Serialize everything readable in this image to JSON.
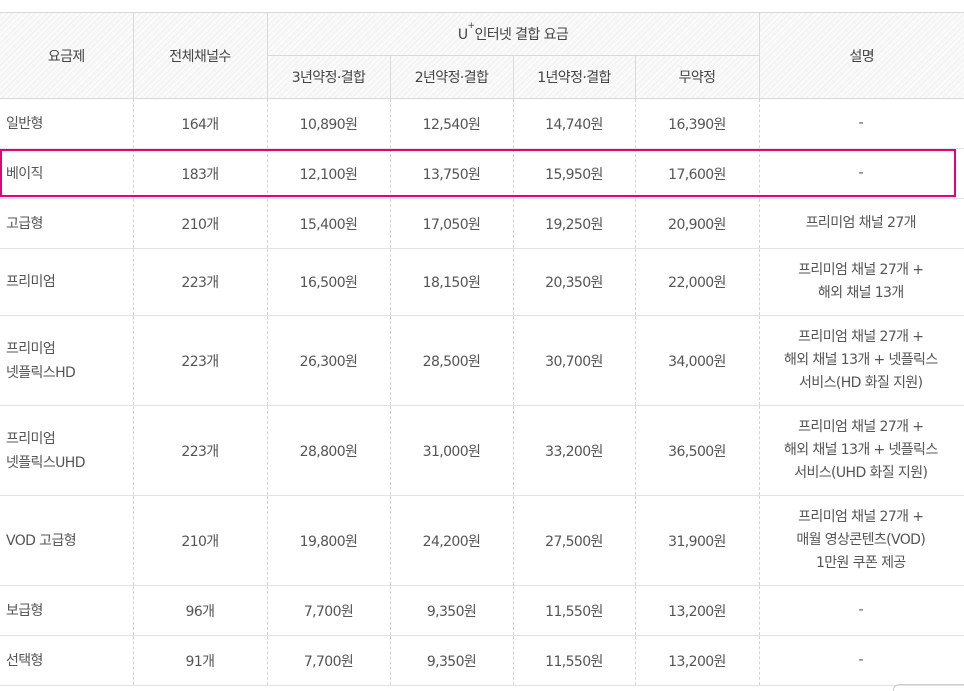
{
  "table": {
    "headers": {
      "plan": "요금제",
      "channels": "전체채널수",
      "group_u": "U",
      "group_plus": "+",
      "group_rest": "인터넷 결합 요금",
      "y3": "3년약정·결합",
      "y2": "2년약정·결합",
      "y1": "1년약정·결합",
      "none": "무약정",
      "desc": "설명"
    },
    "rows": [
      {
        "plan": [
          "일반형"
        ],
        "channels": "164개",
        "y3": "10,890원",
        "y2": "12,540원",
        "y1": "14,740원",
        "none": "16,390원",
        "desc": [
          "-"
        ]
      },
      {
        "plan": [
          "베이직"
        ],
        "channels": "183개",
        "y3": "12,100원",
        "y2": "13,750원",
        "y1": "15,950원",
        "none": "17,600원",
        "desc": [
          "-"
        ]
      },
      {
        "plan": [
          "고급형"
        ],
        "channels": "210개",
        "y3": "15,400원",
        "y2": "17,050원",
        "y1": "19,250원",
        "none": "20,900원",
        "desc": [
          "프리미엄 채널 27개"
        ]
      },
      {
        "plan": [
          "프리미엄"
        ],
        "channels": "223개",
        "y3": "16,500원",
        "y2": "18,150원",
        "y1": "20,350원",
        "none": "22,000원",
        "desc": [
          "프리미엄 채널 27개 +",
          "해외 채널 13개"
        ]
      },
      {
        "plan": [
          "프리미엄",
          "넷플릭스HD"
        ],
        "channels": "223개",
        "y3": "26,300원",
        "y2": "28,500원",
        "y1": "30,700원",
        "none": "34,000원",
        "desc": [
          "프리미엄 채널 27개 +",
          "해외 채널 13개 + 넷플릭스",
          "서비스(HD 화질 지원)"
        ]
      },
      {
        "plan": [
          "프리미엄",
          "넷플릭스UHD"
        ],
        "channels": "223개",
        "y3": "28,800원",
        "y2": "31,000원",
        "y1": "33,200원",
        "none": "36,500원",
        "desc": [
          "프리미엄 채널 27개 +",
          "해외 채널 13개 + 넷플릭스",
          "서비스(UHD 화질 지원)"
        ]
      },
      {
        "plan": [
          "VOD 고급형"
        ],
        "channels": "210개",
        "y3": "19,800원",
        "y2": "24,200원",
        "y1": "27,500원",
        "none": "31,900원",
        "desc": [
          "프리미엄 채널 27개 +",
          "매월 영상콘텐츠(VOD)",
          "1만원 쿠폰 제공"
        ]
      },
      {
        "plan": [
          "보급형"
        ],
        "channels": "96개",
        "y3": "7,700원",
        "y2": "9,350원",
        "y1": "11,550원",
        "none": "13,200원",
        "desc": [
          "-"
        ]
      },
      {
        "plan": [
          "선택형"
        ],
        "channels": "91개",
        "y3": "7,700원",
        "y2": "9,350원",
        "y1": "11,550원",
        "none": "13,200원",
        "desc": [
          "-"
        ]
      }
    ],
    "highlight_color": "#e6007e"
  }
}
